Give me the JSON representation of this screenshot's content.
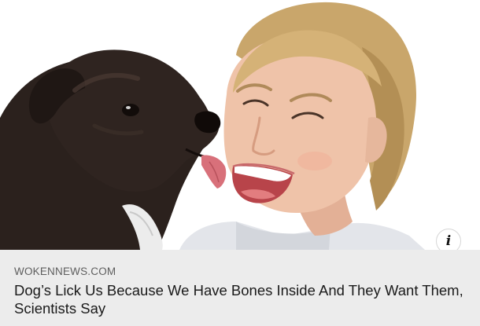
{
  "ad_card": {
    "image_alt": "Dog licking a laughing woman's cheek",
    "info_icon": "info-icon",
    "info_glyph": "i",
    "source": "WOKENNEWS.COM",
    "headline": "Dog’s Lick Us Because We Have Bones Inside And They Want Them, Scientists Say"
  },
  "colors": {
    "caption_background": "#ececec",
    "source_text": "#5e5e5e",
    "headline_text": "#1a1a1a",
    "dog_fur": "#2b211d",
    "hair": "#c9a66b",
    "skin": "#efc3a9"
  }
}
